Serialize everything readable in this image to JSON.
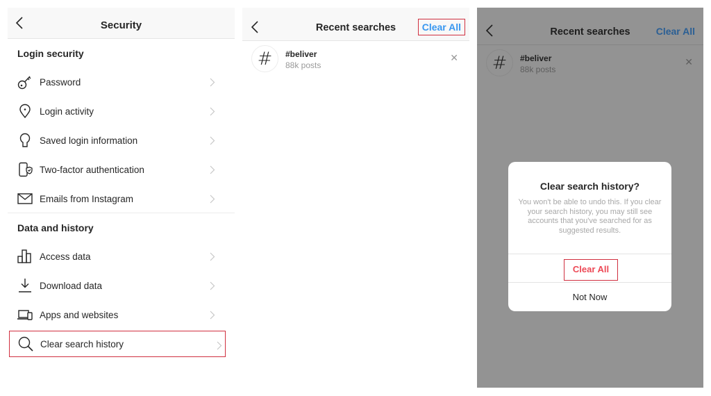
{
  "security_screen": {
    "title": "Security",
    "back_icon": "chevron-left-icon",
    "sections": [
      {
        "title": "Login security",
        "items": [
          {
            "label": "Password",
            "icon": "key-icon"
          },
          {
            "label": "Login activity",
            "icon": "location-pin-icon"
          },
          {
            "label": "Saved login information",
            "icon": "keyhole-icon"
          },
          {
            "label": "Two-factor authentication",
            "icon": "phone-shield-icon"
          },
          {
            "label": "Emails from Instagram",
            "icon": "envelope-icon"
          }
        ]
      },
      {
        "title": "Data and history",
        "items": [
          {
            "label": "Access data",
            "icon": "bar-chart-icon"
          },
          {
            "label": "Download data",
            "icon": "download-icon"
          },
          {
            "label": "Apps and websites",
            "icon": "laptop-phone-icon"
          },
          {
            "label": "Clear search history",
            "icon": "search-icon",
            "highlighted": true
          }
        ]
      }
    ]
  },
  "recent_searches_screen": {
    "title": "Recent searches",
    "clear_all_label": "Clear All",
    "items": [
      {
        "tag": "#beliver",
        "count": "88k posts",
        "icon": "hashtag-icon",
        "remove_icon": "close-icon"
      }
    ]
  },
  "confirm_screen": {
    "title": "Recent searches",
    "clear_all_label": "Clear All",
    "items": [
      {
        "tag": "#beliver",
        "count": "88k posts"
      }
    ],
    "dialog": {
      "title": "Clear search history?",
      "body": "You won't be able to undo this. If you clear your search history, you may still see accounts that you've searched for as suggested results.",
      "confirm_label": "Clear All",
      "cancel_label": "Not Now"
    }
  },
  "colors": {
    "link_blue": "#3897f0",
    "destructive_red": "#ed4956",
    "highlight_box": "#d02f3f",
    "overlay_gray": "#939393"
  }
}
